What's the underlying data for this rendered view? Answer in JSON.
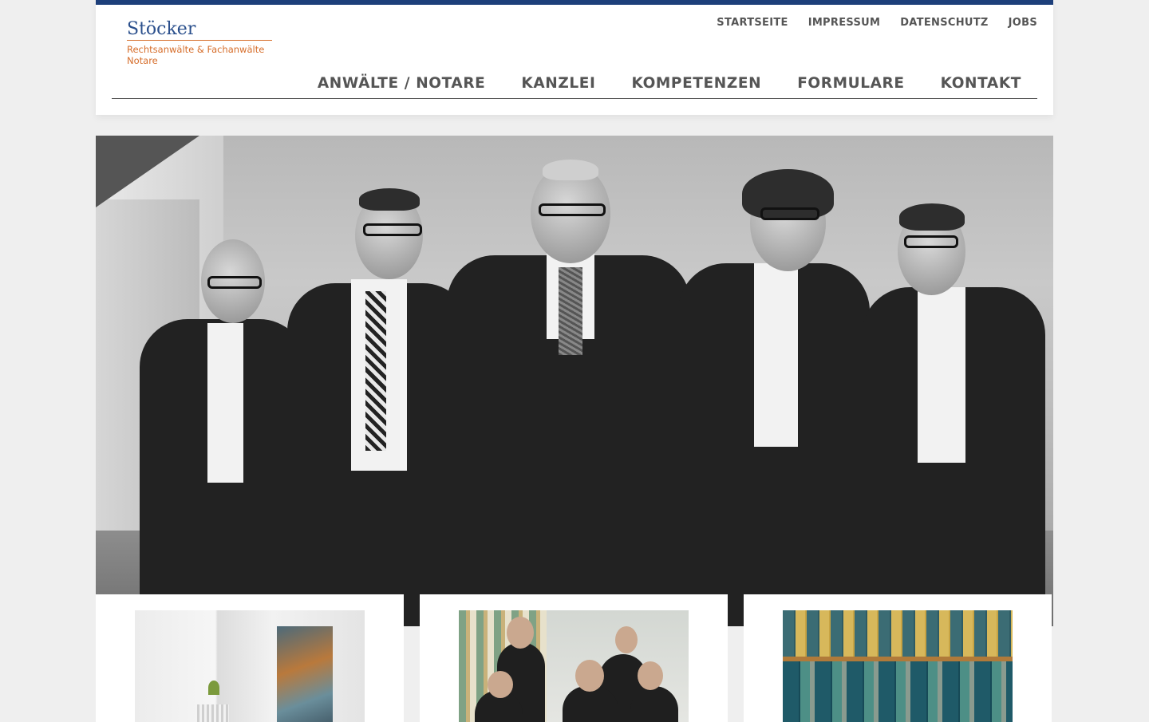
{
  "logo": {
    "name": "Stöcker",
    "subtitle_line1": "Rechtsanwälte & Fachanwälte",
    "subtitle_line2": "Notare"
  },
  "topnav": [
    "STARTSEITE",
    "IMPRESSUM",
    "DATENSCHUTZ",
    "JOBS"
  ],
  "mainnav": [
    "ANWÄLTE / NOTARE",
    "KANZLEI",
    "KOMPETENZEN",
    "FORMULARE",
    "KONTAKT"
  ],
  "colors": {
    "brand_blue": "#1d3f7a",
    "accent_orange": "#d66d2a",
    "nav_text": "#555555"
  },
  "hero": {
    "image": "team-photo-black-white"
  },
  "cards": [
    {
      "image": "office-interior-photo"
    },
    {
      "image": "team-at-table-photo"
    },
    {
      "image": "law-books-shelf-photo"
    }
  ]
}
